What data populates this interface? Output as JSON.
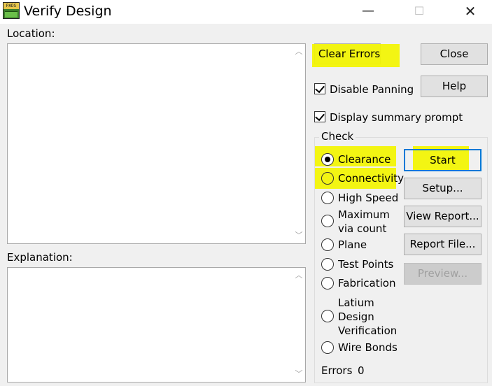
{
  "window": {
    "title": "Verify Design",
    "app_icon_text": "PADS",
    "minimize": "—",
    "maximize": "☐",
    "close": "✕"
  },
  "location": {
    "label": "Location:"
  },
  "explanation": {
    "label": "Explanation:"
  },
  "buttons": {
    "clear_errors": "Clear Errors",
    "close": "Close",
    "help": "Help",
    "start": "Start",
    "setup": "Setup...",
    "view_report": "View Report...",
    "report_file": "Report File...",
    "preview": "Preview..."
  },
  "options": {
    "disable_panning": "Disable Panning",
    "display_summary_prompt": "Display summary prompt"
  },
  "check": {
    "group_label": "Check",
    "items": [
      {
        "label": "Clearance",
        "selected": true
      },
      {
        "label": "Connectivity",
        "selected": false
      },
      {
        "label": "High Speed",
        "selected": false
      },
      {
        "label": "Maximum via count",
        "line1": "Maximum",
        "line2": "via count",
        "selected": false
      },
      {
        "label": "Plane",
        "selected": false
      },
      {
        "label": "Test Points",
        "selected": false
      },
      {
        "label": "Fabrication",
        "selected": false
      },
      {
        "label": "Latium Design Verification",
        "line1": "Latium",
        "line2": "Design",
        "line3": "Verification",
        "selected": false
      },
      {
        "label": "Wire Bonds",
        "selected": false
      }
    ],
    "errors_label": "Errors",
    "errors_count": "0"
  },
  "colors": {
    "highlight": "#f3f500",
    "default_button_border": "#0078d7"
  }
}
